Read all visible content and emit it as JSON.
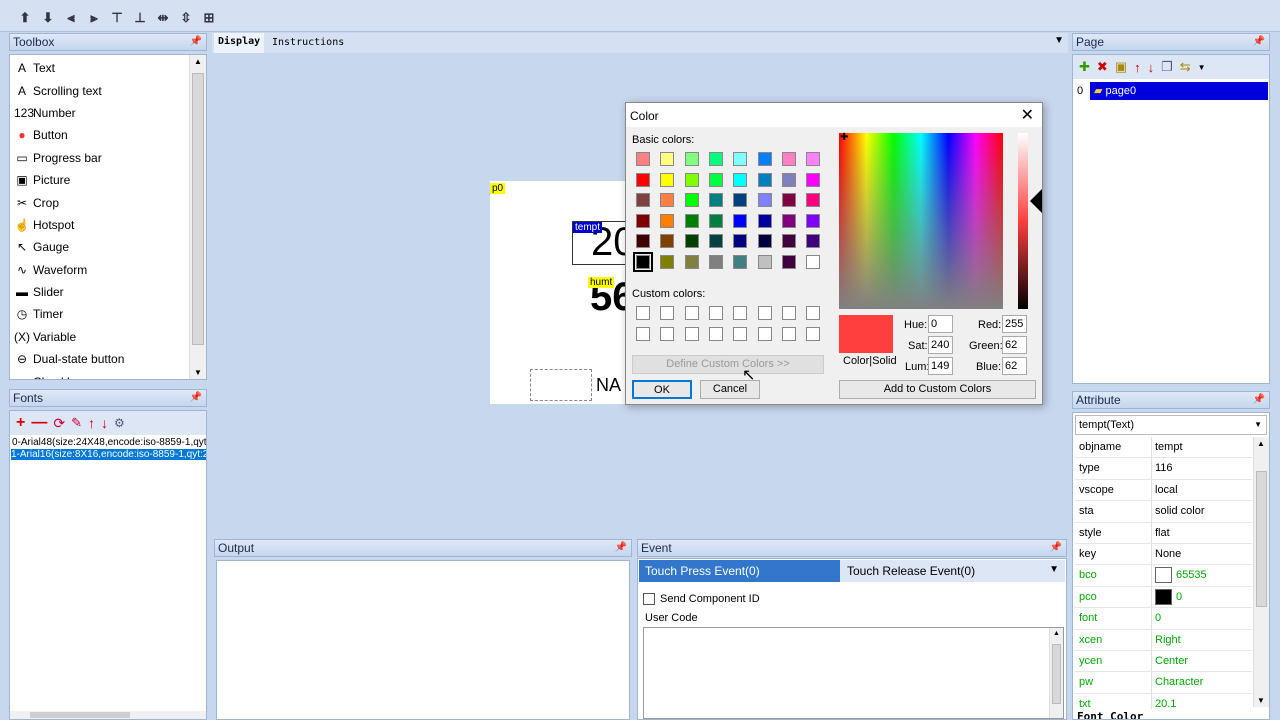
{
  "toolbar_icons": [
    "arrow-up",
    "arrow-down",
    "align-left",
    "align-right",
    "align-top",
    "align-bottom",
    "center-horizontal",
    "center-vertical",
    "grid"
  ],
  "toolbox": {
    "title": "Toolbox",
    "items": [
      {
        "icon": "A",
        "label": "Text"
      },
      {
        "icon": "A",
        "label": "Scrolling text"
      },
      {
        "icon": "123",
        "label": "Number"
      },
      {
        "icon": "●",
        "label": "Button"
      },
      {
        "icon": "▭",
        "label": "Progress bar"
      },
      {
        "icon": "▣",
        "label": "Picture"
      },
      {
        "icon": "✂",
        "label": "Crop"
      },
      {
        "icon": "☝",
        "label": "Hotspot"
      },
      {
        "icon": "↖",
        "label": "Gauge"
      },
      {
        "icon": "∿",
        "label": "Waveform"
      },
      {
        "icon": "▬",
        "label": "Slider"
      },
      {
        "icon": "◷",
        "label": "Timer"
      },
      {
        "icon": "(X)",
        "label": "Variable"
      },
      {
        "icon": "⊖",
        "label": "Dual-state button"
      },
      {
        "icon": "■",
        "label": "Checkbox"
      }
    ]
  },
  "fonts": {
    "title": "Fonts",
    "items": [
      "0-Arial48(size:24X48,encode:iso-8859-1,qyt:",
      "1-Arial16(size:8X16,encode:iso-8859-1,qyt:2"
    ]
  },
  "tabs": {
    "display": "Display",
    "instructions": "Instructions"
  },
  "canvas": {
    "page_label": "p0",
    "tempt_label": "tempt",
    "tempt_value": "20",
    "humt_label": "humt",
    "humt_value": "56",
    "chart_text": "NA"
  },
  "output": {
    "title": "Output"
  },
  "event": {
    "title": "Event",
    "tab1": "Touch Press Event(0)",
    "tab2": "Touch Release Event(0)",
    "send_id": "Send Component ID",
    "user_code": "User Code"
  },
  "page": {
    "title": "Page",
    "index": "0",
    "name": "page0"
  },
  "attribute": {
    "title": "Attribute",
    "selector": "tempt(Text)",
    "rows": [
      {
        "k": "objname",
        "v": "tempt",
        "green": false
      },
      {
        "k": "type",
        "v": "116",
        "green": false
      },
      {
        "k": "vscope",
        "v": "local",
        "green": false
      },
      {
        "k": "sta",
        "v": "solid color",
        "green": false
      },
      {
        "k": "style",
        "v": "flat",
        "green": false
      },
      {
        "k": "key",
        "v": "None",
        "green": false
      },
      {
        "k": "bco",
        "v": "65535",
        "green": true,
        "swatch": "#ffffff"
      },
      {
        "k": "pco",
        "v": "0",
        "green": true,
        "swatch": "#000000"
      },
      {
        "k": "font",
        "v": "0",
        "green": true
      },
      {
        "k": "xcen",
        "v": "Right",
        "green": true
      },
      {
        "k": "ycen",
        "v": "Center",
        "green": true
      },
      {
        "k": "pw",
        "v": "Character",
        "green": true
      },
      {
        "k": "txt",
        "v": "20.1",
        "green": true
      }
    ],
    "footer": "Font Color"
  },
  "color_dialog": {
    "title": "Color",
    "basic_label": "Basic colors:",
    "custom_label": "Custom colors:",
    "define_btn": "Define Custom Colors >>",
    "ok": "OK",
    "cancel": "Cancel",
    "color_solid": "Color|Solid",
    "add_btn": "Add to Custom Colors",
    "hue_label": "Hue:",
    "hue": "0",
    "sat_label": "Sat:",
    "sat": "240",
    "lum_label": "Lum:",
    "lum": "149",
    "red_label": "Red:",
    "red": "255",
    "green_label": "Green:",
    "green": "62",
    "blue_label": "Blue:",
    "blue": "62",
    "current_color": "#ff3e3e",
    "basic_colors": [
      "#ff8080",
      "#ffff80",
      "#80ff80",
      "#00ff80",
      "#80ffff",
      "#0080ff",
      "#ff80c0",
      "#ff80ff",
      "#ff0000",
      "#ffff00",
      "#80ff00",
      "#00ff40",
      "#00ffff",
      "#0080c0",
      "#8080c0",
      "#ff00ff",
      "#804040",
      "#ff8040",
      "#00ff00",
      "#008080",
      "#004080",
      "#8080ff",
      "#800040",
      "#ff0080",
      "#800000",
      "#ff8000",
      "#008000",
      "#008040",
      "#0000ff",
      "#0000a0",
      "#800080",
      "#8000ff",
      "#400000",
      "#804000",
      "#004000",
      "#004040",
      "#000080",
      "#000040",
      "#400040",
      "#400080",
      "#000000",
      "#808000",
      "#808040",
      "#808080",
      "#408080",
      "#c0c0c0",
      "#400040",
      "#ffffff"
    ]
  }
}
